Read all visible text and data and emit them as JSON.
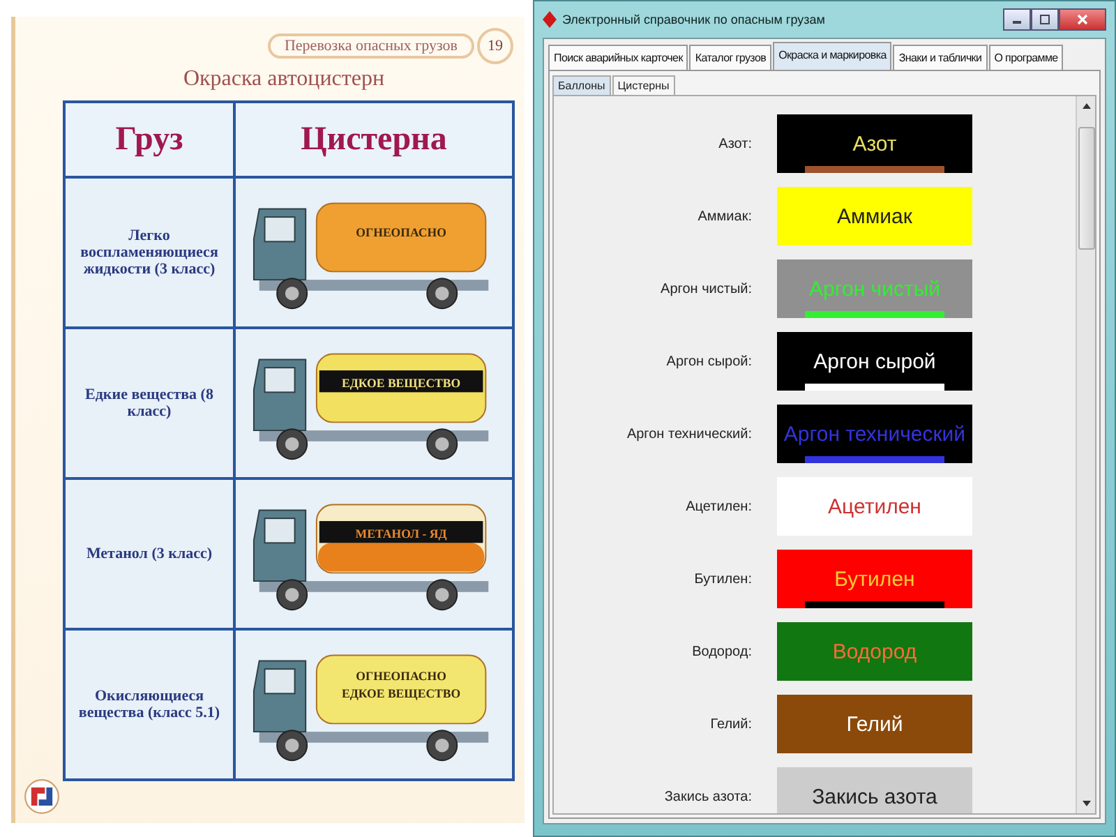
{
  "slide": {
    "header": "Перевозка опасных грузов",
    "page_number": "19",
    "title": "Окраска автоцистерн",
    "columns": [
      "Груз",
      "Цистерна"
    ],
    "rows": [
      {
        "cargo": "Легко воспламеняющиеся жидкости (3 класс)",
        "tank": {
          "kind": "plain",
          "color": "#f0a030",
          "labels": [
            {
              "text": "ОГНЕОПАСНО",
              "color": "#3a2a10"
            }
          ]
        }
      },
      {
        "cargo": "Едкие вещества (8 класс)",
        "tank": {
          "kind": "band",
          "color": "#f2e060",
          "band": {
            "color": "#111111"
          },
          "labels": [
            {
              "text": "ЕДКОЕ ВЕЩЕСТВО",
              "color": "#f0e080"
            }
          ]
        }
      },
      {
        "cargo": "Метанол (3 класс)",
        "tank": {
          "kind": "split",
          "color": "#f8ecc8",
          "band": {
            "color": "#111111"
          },
          "lower": {
            "color": "#e8801c"
          },
          "labels": [
            {
              "text": "МЕТАНОЛ - ЯД",
              "color": "#e88a30"
            }
          ]
        }
      },
      {
        "cargo": "Окисляющиеся вещества (класс 5.1)",
        "tank": {
          "kind": "plain",
          "color": "#f3e670",
          "labels": [
            {
              "text": "ОГНЕОПАСНО",
              "color": "#3a2a10"
            },
            {
              "text": "ЕДКОЕ ВЕЩЕСТВО",
              "color": "#3a2a10"
            }
          ]
        }
      }
    ]
  },
  "window": {
    "title": "Электронный справочник по опасным грузам",
    "tabs": [
      {
        "label": "Поиск аварийных карточек",
        "selected": false
      },
      {
        "label": "Каталог грузов",
        "selected": false
      },
      {
        "label": "Окраска и маркировка",
        "selected": true
      },
      {
        "label": "Знаки и таблички",
        "selected": false
      },
      {
        "label": "О программе",
        "selected": false
      }
    ],
    "subtabs": [
      {
        "label": "Баллоны",
        "selected": true
      },
      {
        "label": "Цистерны",
        "selected": false
      }
    ],
    "gases": [
      {
        "label": "Азот:",
        "color": "#000000",
        "name": {
          "text": "Азот",
          "color": "#e8e060"
        },
        "stripe": {
          "color": "#a0522d"
        }
      },
      {
        "label": "Аммиак:",
        "color": "#ffff00",
        "name": {
          "text": "Аммиак",
          "color": "#222222"
        }
      },
      {
        "label": "Аргон чистый:",
        "color": "#909090",
        "name": {
          "text": "Аргон чистый",
          "color": "#33ee33"
        },
        "stripe": {
          "color": "#33ee33"
        }
      },
      {
        "label": "Аргон сырой:",
        "color": "#000000",
        "name": {
          "text": "Аргон сырой",
          "color": "#ffffff"
        },
        "stripe": {
          "color": "#ffffff"
        }
      },
      {
        "label": "Аргон технический:",
        "color": "#000000",
        "name": {
          "text": "Аргон технический",
          "color": "#3333dd"
        },
        "stripe": {
          "color": "#3333dd"
        }
      },
      {
        "label": "Ацетилен:",
        "color": "#ffffff",
        "name": {
          "text": "Ацетилен",
          "color": "#cc3333"
        }
      },
      {
        "label": "Бутилен:",
        "color": "#ff0000",
        "name": {
          "text": "Бутилен",
          "color": "#ffcc33"
        },
        "stripe": {
          "color": "#000000"
        }
      },
      {
        "label": "Водород:",
        "color": "#117711",
        "name": {
          "text": "Водород",
          "color": "#ff6a3a"
        }
      },
      {
        "label": "Гелий:",
        "color": "#8b4a0a",
        "name": {
          "text": "Гелий",
          "color": "#ffffff"
        }
      },
      {
        "label": "Закись азота:",
        "color": "#cccccc",
        "name": {
          "text": "Закись азота",
          "color": "#222222"
        }
      }
    ]
  }
}
